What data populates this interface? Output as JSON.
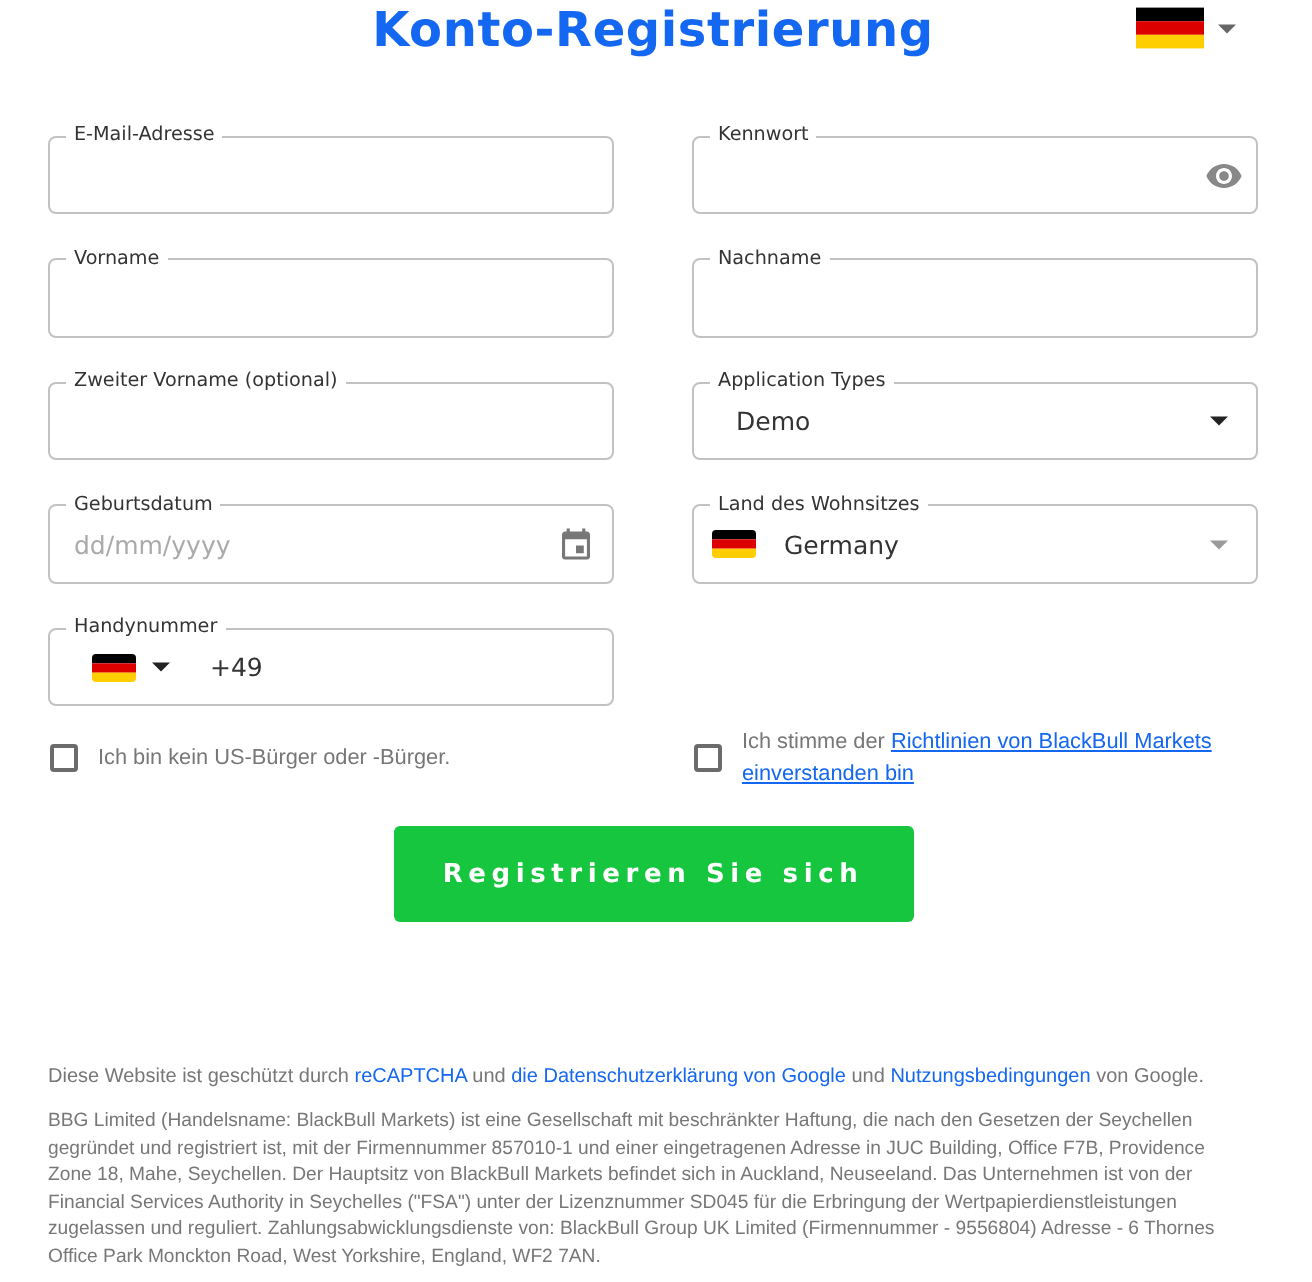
{
  "header": {
    "title": "Konto-Registrierung"
  },
  "fields": [
    {
      "kind": "text",
      "label": "E-Mail-Adresse"
    },
    {
      "kind": "password",
      "label": "Kennwort"
    },
    {
      "kind": "text",
      "label": "Vorname"
    },
    {
      "kind": "text",
      "label": "Nachname"
    },
    {
      "kind": "text",
      "label": "Zweiter Vorname (optional)"
    },
    {
      "kind": "select",
      "label": "Application Types",
      "value": "Demo"
    },
    {
      "kind": "date",
      "label": "Geburtsdatum",
      "placeholder": "dd/mm/yyyy"
    },
    {
      "kind": "country",
      "label": "Land des Wohnsitzes",
      "value": "Germany"
    },
    {
      "kind": "phone",
      "label": "Handynummer",
      "value": "+49"
    }
  ],
  "consents": [
    {
      "checked": false,
      "text": "Ich bin kein US-Bürger oder -Bürger."
    },
    {
      "checked": false,
      "text": "Ich stimme der",
      "link_lines": [
        "Richtlinien von BlackBull Markets",
        "einverstanden bin"
      ]
    }
  ],
  "submit_button": {
    "label": "Registrieren Sie sich"
  },
  "footer": {
    "recaptcha_notice": [
      {
        "kind": "text",
        "text": "Diese Website ist geschützt durch"
      },
      {
        "kind": "link",
        "text": "reCAPTCHA"
      },
      {
        "kind": "text",
        "text": "und"
      },
      {
        "kind": "link",
        "text": "die Datenschutzerklärung von Google"
      },
      {
        "kind": "text",
        "text": "und"
      },
      {
        "kind": "link",
        "text": "Nutzungsbedingungen"
      },
      {
        "kind": "text",
        "text": "von Google."
      }
    ],
    "legal_text": "BBG Limited (Handelsname: BlackBull Markets) ist eine Gesellschaft mit beschränkter Haftung, die nach den Gesetzen der Seychellen gegründet und registriert ist, mit der Firmennummer 857010-1 und einer eingetragenen Adresse in JUC Building, Office F7B, Providence Zone 18, Mahe, Seychellen. Der Hauptsitz von BlackBull Markets befindet sich in Auckland, Neuseeland. Das Unternehmen ist von der Financial Services Authority in Seychelles (\"FSA\") unter der Lizenznummer SD045 für die Erbringung der Wertpapierdienstleistungen zugelassen und reguliert. Zahlungsabwicklungsdienste von: BlackBull Group UK Limited (Firmennummer - 9556804) Adresse - 6 Thornes Office Park Monckton Road, West Yorkshire, England, WF2 7AN."
  }
}
